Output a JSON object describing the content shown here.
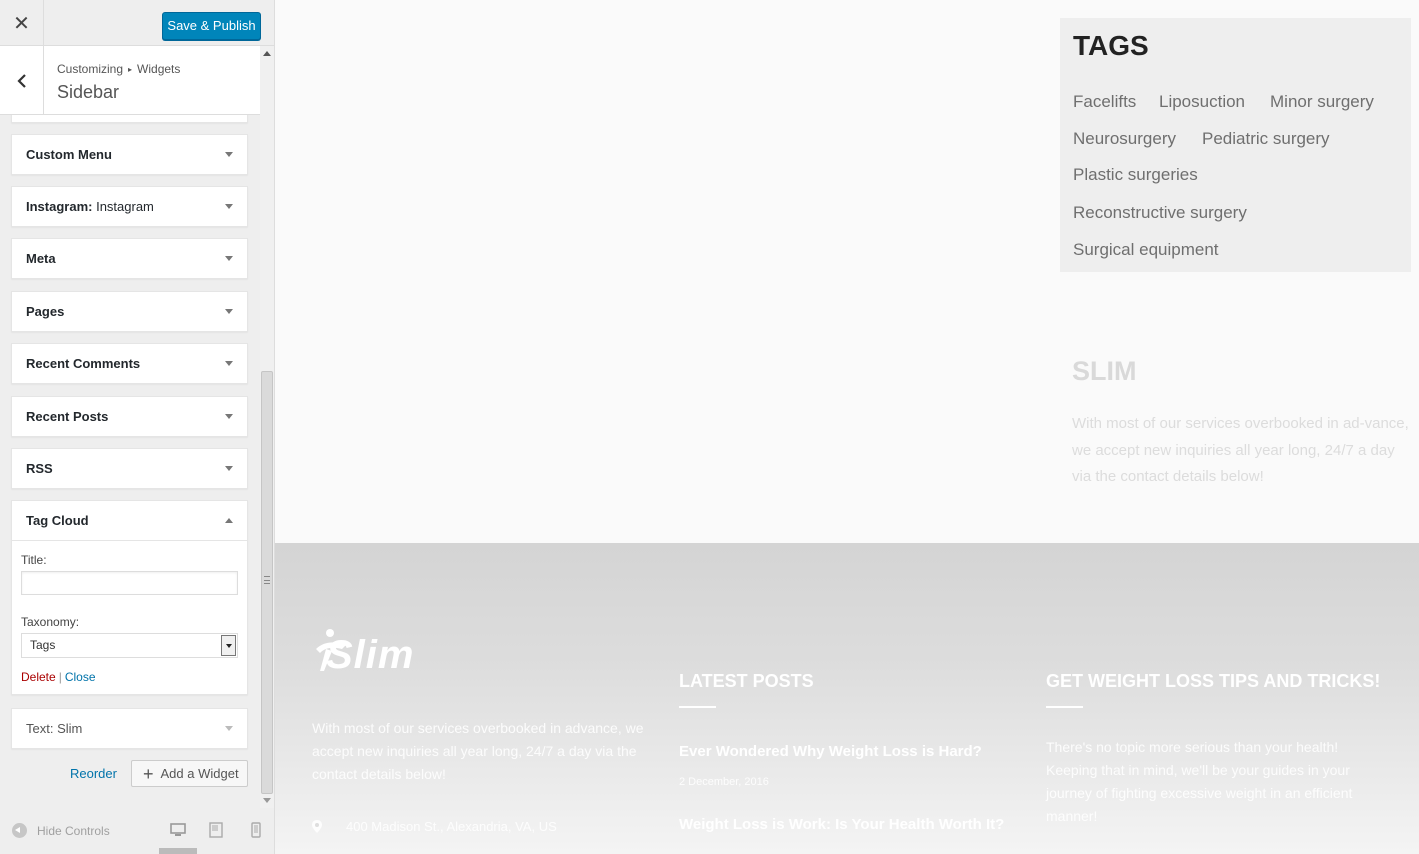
{
  "customizer": {
    "publish_label": "Save & Publish",
    "breadcrumb": {
      "root": "Customizing",
      "separator": "▸",
      "section": "Widgets"
    },
    "panel_title": "Sidebar",
    "widgets": [
      {
        "title": "Custom Menu",
        "subtitle": ""
      },
      {
        "title": "Instagram:",
        "subtitle": " Instagram"
      },
      {
        "title": "Meta",
        "subtitle": ""
      },
      {
        "title": "Pages",
        "subtitle": ""
      },
      {
        "title": "Recent Comments",
        "subtitle": ""
      },
      {
        "title": "Recent Posts",
        "subtitle": ""
      },
      {
        "title": "RSS",
        "subtitle": ""
      },
      {
        "title": "Tag Cloud",
        "subtitle": ""
      },
      {
        "title": "Text:",
        "subtitle": " Slim"
      }
    ],
    "tag_cloud_form": {
      "title_label": "Title:",
      "title_value": "",
      "taxonomy_label": "Taxonomy:",
      "taxonomy_value": "Tags",
      "delete_label": "Delete",
      "separator": "|",
      "close_label": "Close"
    },
    "reorder_label": "Reorder",
    "add_widget_label": "Add a Widget",
    "hide_controls_label": "Hide Controls"
  },
  "preview": {
    "tags": {
      "title": "TAGS",
      "items": [
        "Facelifts",
        "Liposuction",
        "Minor surgery",
        "Neurosurgery",
        "Pediatric surgery",
        "Plastic surgeries",
        "Reconstructive surgery",
        "Surgical equipment"
      ]
    },
    "slim": {
      "title": "SLIM",
      "text": "With most of our services overbooked in ad-vance, we accept new inquiries all year long, 24/7 a day via the contact details below!"
    },
    "footer": {
      "logo": "Slim",
      "about": "With most of our services overbooked in advance, we accept new inquiries all year long, 24/7 a day via the contact details below!",
      "address": "400 Madison St., Alexandria, VA, US",
      "latest_posts_heading": "LATEST POSTS",
      "posts": [
        "Ever Wondered Why Weight Loss is Hard?",
        "Weight Loss is Work: Is Your Health Worth It?"
      ],
      "post_date": "2 December, 2016",
      "tips_heading": "GET WEIGHT LOSS TIPS AND TRICKS!",
      "tips_text": "There's no topic more serious than your health! Keeping that in mind, we'll be your guides in your journey of fighting excessive weight in an efficient manner!"
    }
  },
  "colors": {
    "publish_button": "#0085ba",
    "link": "#0073aa",
    "delete_link": "#aa0000"
  },
  "icons": {
    "close": "close-icon",
    "back": "chevron-left-icon",
    "expand": "arrow-down-icon",
    "collapse": "arrow-up-icon",
    "add": "plus-icon",
    "hide": "collapse-circle-icon",
    "desktop": "desktop-icon",
    "tablet": "tablet-icon",
    "mobile": "mobile-icon",
    "location": "map-pin-icon"
  }
}
